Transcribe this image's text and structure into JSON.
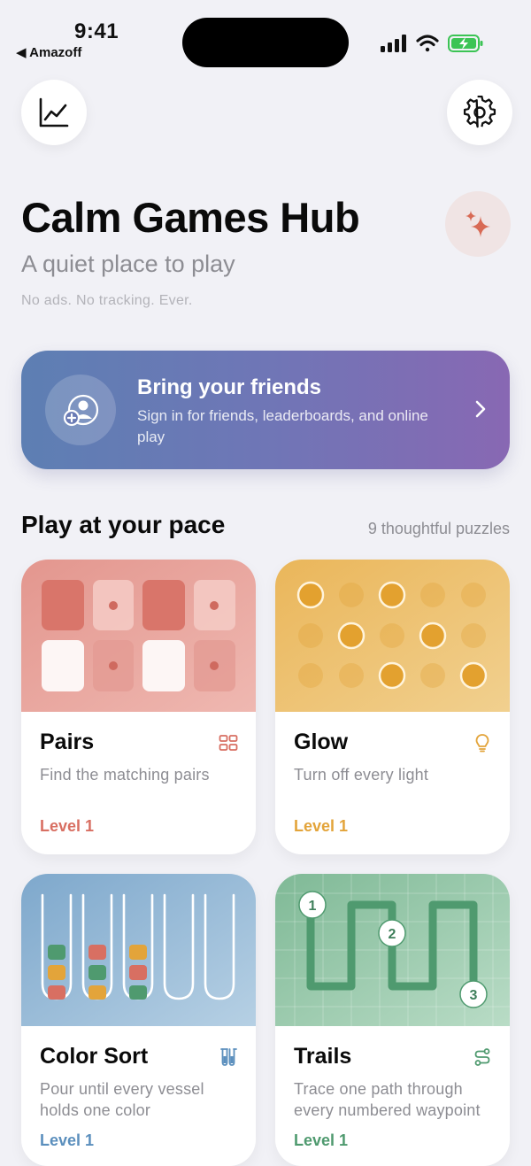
{
  "status_bar": {
    "time": "9:41",
    "back_app": "◀ Amazoff"
  },
  "header": {
    "stats_icon": "chart-line-icon",
    "settings_icon": "gear-icon",
    "title": "Calm Games Hub",
    "subtitle": "A quiet place to play",
    "tagline": "No ads. No tracking. Ever.",
    "sparkle_icon": "sparkle-icon"
  },
  "friends_banner": {
    "title": "Bring your friends",
    "subtitle": "Sign in for friends, leaderboards, and online play"
  },
  "section": {
    "title": "Play at your pace",
    "count": "9 thoughtful puzzles"
  },
  "games": [
    {
      "name": "Pairs",
      "description": "Find the matching pairs",
      "level": "Level 1",
      "accent": "#d86f62",
      "icon": "grid-icon"
    },
    {
      "name": "Glow",
      "description": "Turn off every light",
      "level": "Level 1",
      "accent": "#e3a43a",
      "icon": "lightbulb-icon"
    },
    {
      "name": "Color Sort",
      "description": "Pour until every vessel holds one color",
      "level": "Level 1",
      "accent": "#5b8fbd",
      "icon": "test-tubes-icon"
    },
    {
      "name": "Trails",
      "description": "Trace one path through every numbered waypoint",
      "level": "Level 1",
      "accent": "#4f9a6f",
      "icon": "path-icon"
    }
  ],
  "trail_waypoints": [
    "1",
    "2",
    "3"
  ]
}
